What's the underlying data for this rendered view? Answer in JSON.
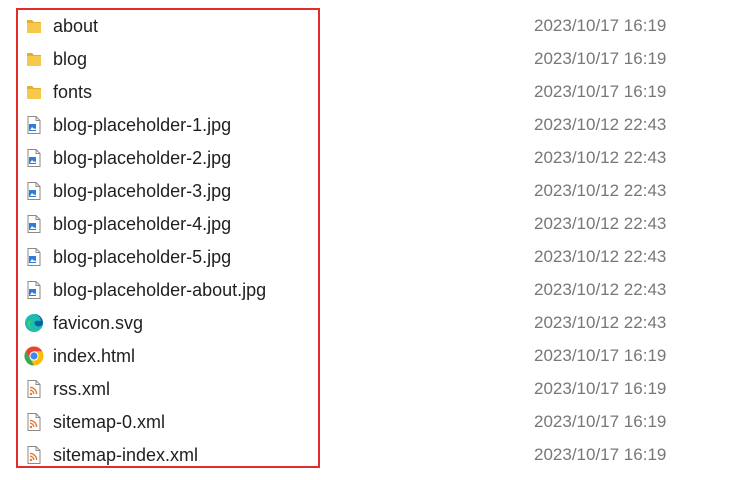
{
  "files": [
    {
      "name": "about",
      "modified": "2023/10/17 16:19",
      "icon": "folder-icon"
    },
    {
      "name": "blog",
      "modified": "2023/10/17 16:19",
      "icon": "folder-icon"
    },
    {
      "name": "fonts",
      "modified": "2023/10/17 16:19",
      "icon": "folder-icon"
    },
    {
      "name": "blog-placeholder-1.jpg",
      "modified": "2023/10/12 22:43",
      "icon": "image-file-icon"
    },
    {
      "name": "blog-placeholder-2.jpg",
      "modified": "2023/10/12 22:43",
      "icon": "image-file-icon"
    },
    {
      "name": "blog-placeholder-3.jpg",
      "modified": "2023/10/12 22:43",
      "icon": "image-file-icon"
    },
    {
      "name": "blog-placeholder-4.jpg",
      "modified": "2023/10/12 22:43",
      "icon": "image-file-icon"
    },
    {
      "name": "blog-placeholder-5.jpg",
      "modified": "2023/10/12 22:43",
      "icon": "image-file-icon"
    },
    {
      "name": "blog-placeholder-about.jpg",
      "modified": "2023/10/12 22:43",
      "icon": "image-file-icon"
    },
    {
      "name": "favicon.svg",
      "modified": "2023/10/12 22:43",
      "icon": "edge-browser-icon"
    },
    {
      "name": "index.html",
      "modified": "2023/10/17 16:19",
      "icon": "chrome-browser-icon"
    },
    {
      "name": "rss.xml",
      "modified": "2023/10/17 16:19",
      "icon": "rss-file-icon"
    },
    {
      "name": "sitemap-0.xml",
      "modified": "2023/10/17 16:19",
      "icon": "rss-file-icon"
    },
    {
      "name": "sitemap-index.xml",
      "modified": "2023/10/17 16:19",
      "icon": "rss-file-icon"
    }
  ],
  "colors": {
    "selection_border": "#e32d2d",
    "folder": "#f4c64a",
    "date_text": "#777777"
  }
}
